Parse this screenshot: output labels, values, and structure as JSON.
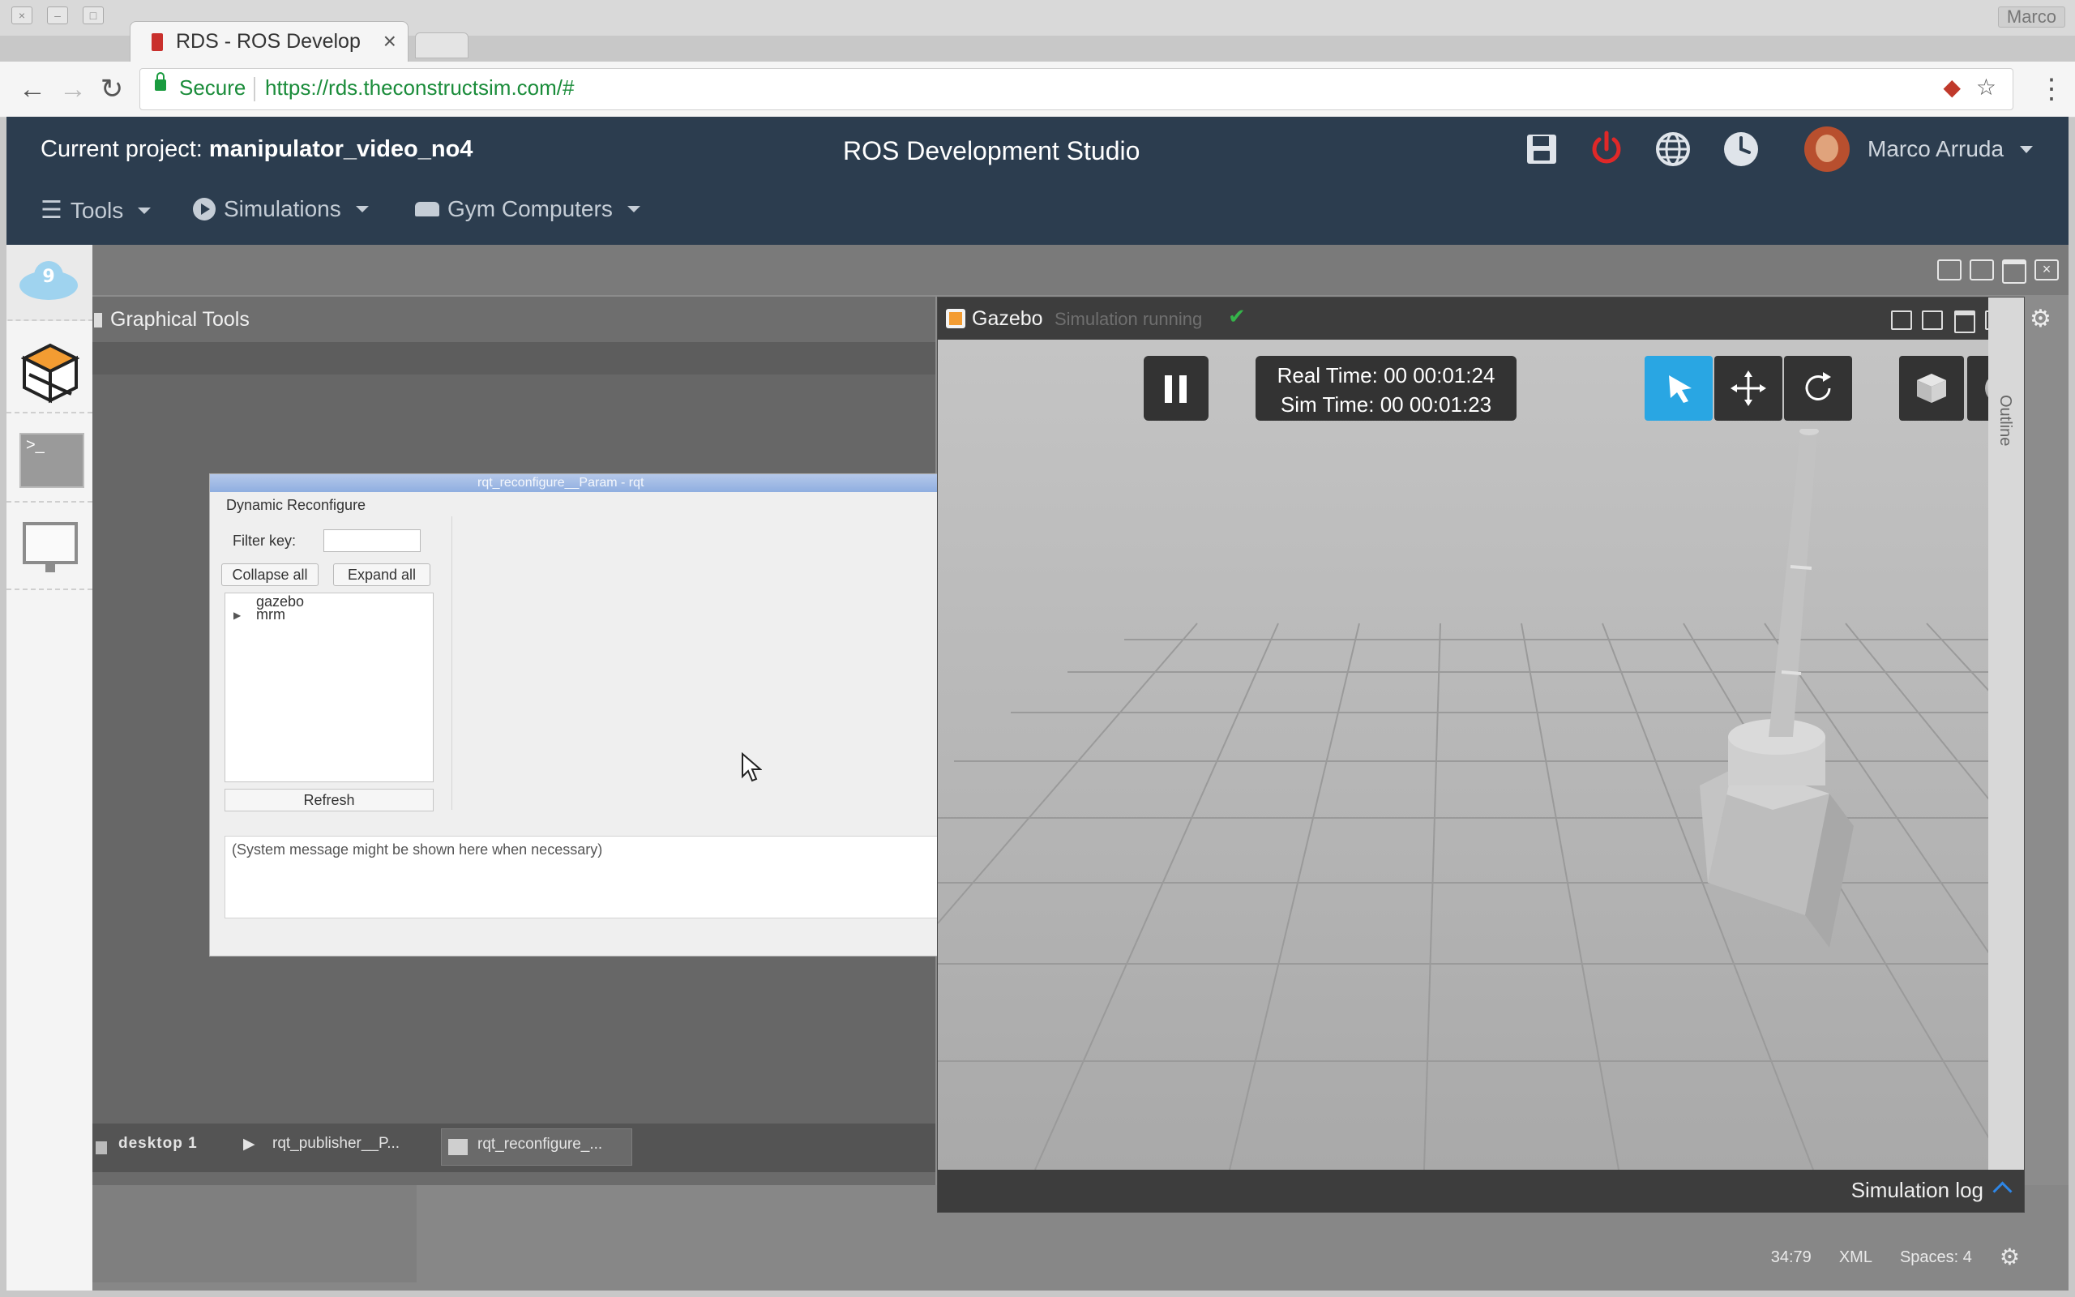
{
  "browser": {
    "os_user": "Marco",
    "tab_title": "RDS - ROS Develop",
    "secure_label": "Secure",
    "url": "https://rds.theconstructsim.com/#"
  },
  "header": {
    "project_prefix": "Current project:",
    "project_name": "manipulator_video_no4",
    "app_title": "ROS Development Studio",
    "user_name": "Marco Arruda"
  },
  "menu": {
    "tools": "Tools",
    "simulations": "Simulations",
    "gym": "Gym Computers"
  },
  "graphical_tools": {
    "title": "Graphical Tools",
    "rqt": {
      "window_title": "rqt_reconfigure__Param - rqt",
      "plugin_title": "Dynamic Reconfigure",
      "filter_label": "Filter key:",
      "collapse_all": "Collapse all",
      "expand_all": "Expand all",
      "tree": [
        "gazebo",
        "mrm"
      ],
      "refresh": "Refresh",
      "message": "(System message might be shown here when necessary)"
    },
    "taskbar": {
      "desktop": "desktop 1",
      "task1": "rqt_publisher__P...",
      "task2": "rqt_reconfigure_..."
    }
  },
  "gazebo": {
    "title": "Gazebo",
    "status": "Simulation running",
    "real_time": "Real Time: 00 00:01:24",
    "sim_time": "Sim Time: 00 00:01:23",
    "outline": "Outline",
    "log": "Simulation log"
  },
  "status": {
    "position": "34:79",
    "mode": "XML",
    "spaces": "Spaces: 4"
  },
  "colors": {
    "header_bg": "#2c3d4f",
    "accent_blue": "#29a6e3",
    "power_red": "#e02828",
    "secure_green": "#1a8c3a"
  }
}
